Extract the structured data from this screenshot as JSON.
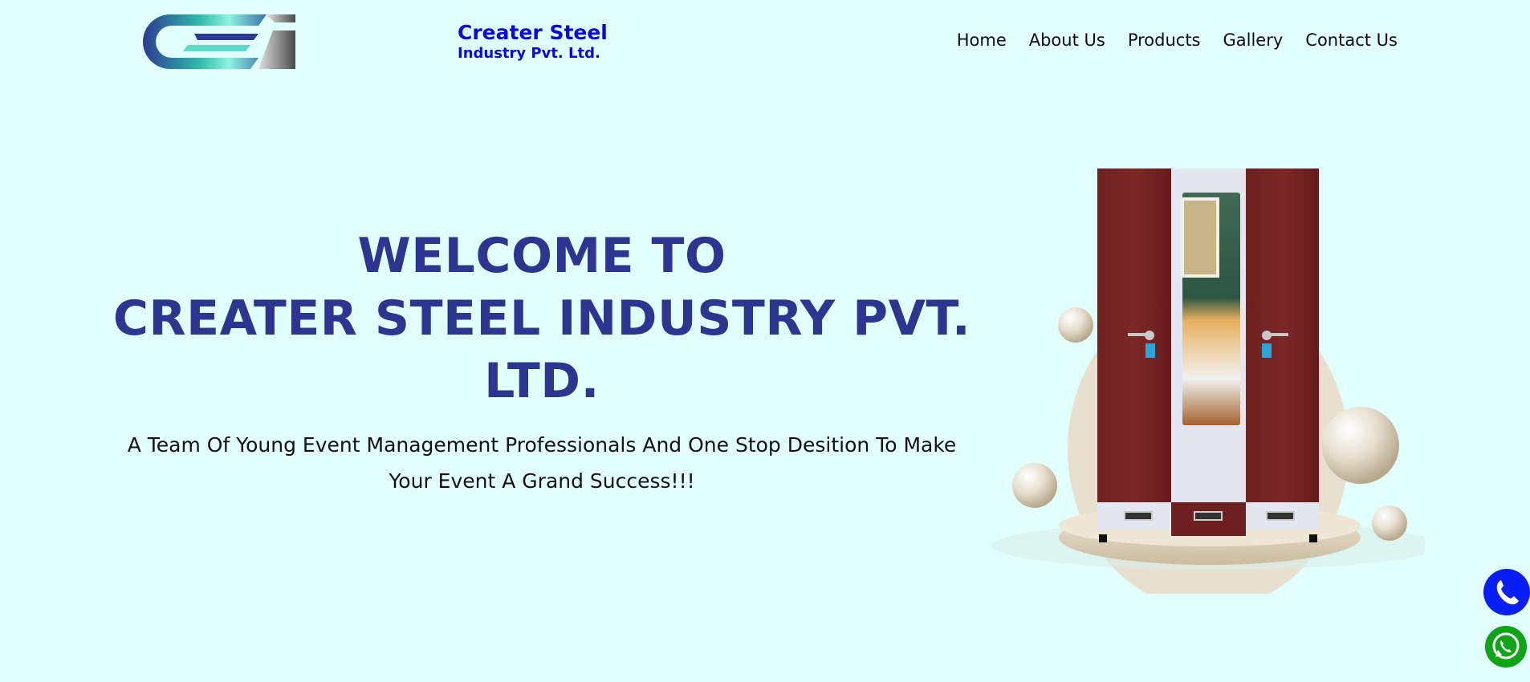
{
  "header": {
    "logo": {
      "icon": "csi-logo-icon",
      "colors": [
        "#2d3a93",
        "#5fd8c9",
        "#6c6c6c"
      ]
    },
    "brand_name": "Creater Steel",
    "brand_sub": "Industry Pvt. Ltd.",
    "nav": [
      {
        "label": "Home"
      },
      {
        "label": "About Us"
      },
      {
        "label": "Products"
      },
      {
        "label": "Gallery"
      },
      {
        "label": "Contact Us"
      }
    ]
  },
  "hero": {
    "title_line1": "WELCOME TO",
    "title_line2": "CREATER STEEL INDUSTRY PVT.",
    "title_line3": "LTD.",
    "subtitle_line1": "A Team Of Young Event Management Professionals And One Stop Desition To Make",
    "subtitle_line2": "Your Event A Grand Success!!!",
    "image": {
      "icon": "steel-almirah-image"
    }
  },
  "floating": {
    "call": {
      "icon": "phone-icon"
    },
    "whatsapp": {
      "icon": "whatsapp-icon"
    }
  },
  "colors": {
    "background": "#e1fffc",
    "title": "#2c3590",
    "brand": "#0b06e6",
    "call_button": "#0a1ff5",
    "whatsapp_button": "#0fa316"
  }
}
